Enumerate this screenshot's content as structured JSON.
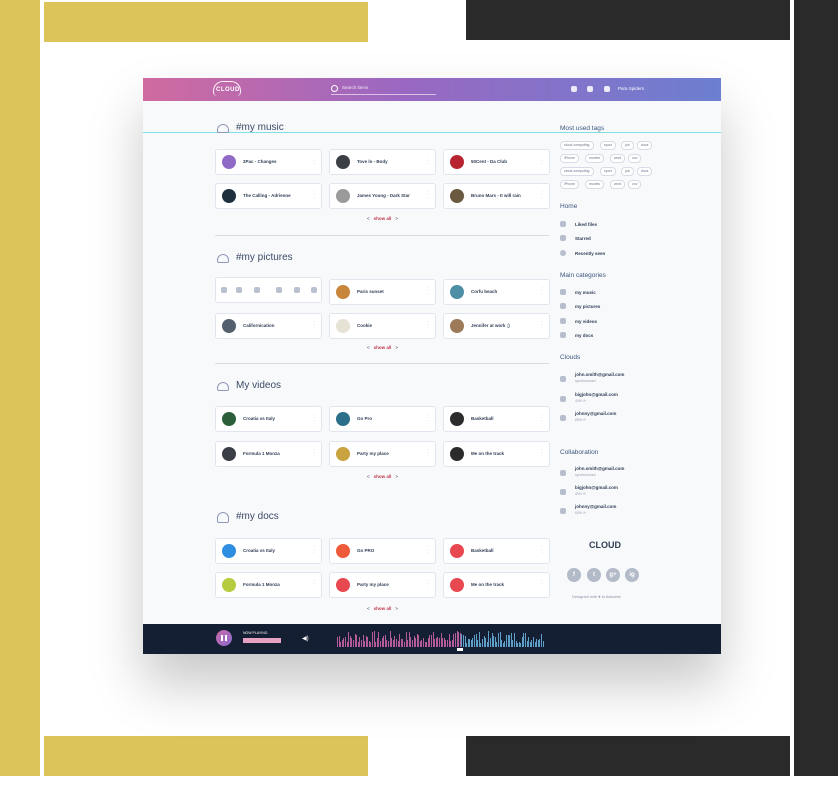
{
  "topbar": {
    "logo": "CLOUD",
    "search_placeholder": "Search items",
    "user_name": "Para Spiders"
  },
  "sections": {
    "music": {
      "title": "#my music",
      "items": [
        "2Pac - Changes",
        "Tove lo - Body",
        "50Cent - Da Club",
        "The Calling - Adrienne",
        "James Young - Dark Star",
        "Bruno Mars - It will rain"
      ],
      "pager": {
        "prev": "<",
        "label": "show all",
        "next": ">"
      }
    },
    "pictures": {
      "title": "#my pictures",
      "items": [
        "Paris sunset",
        "Corfu beach",
        "Californication",
        "Cookie",
        "Jennifer at work ;)"
      ],
      "pager": {
        "prev": "<",
        "label": "show all",
        "next": ">"
      }
    },
    "videos": {
      "title": "My videos",
      "items": [
        "Croatia vs Italy",
        "Go Pro",
        "Basketball",
        "Formula 1 Monza",
        "Party my place",
        "Me on the track"
      ],
      "pager": {
        "prev": "<",
        "label": "show all",
        "next": ">"
      }
    },
    "docs": {
      "title": "#my docs",
      "items": [
        "Croatia vs Italy",
        "Go PRO",
        "Basketball",
        "Formula 1 Monza",
        "Party my place",
        "Me on the track"
      ],
      "pager": {
        "prev": "<",
        "label": "show all",
        "next": ">"
      }
    }
  },
  "sidebar": {
    "tags_title": "Most used tags",
    "tags": [
      "cloud computing",
      "sport",
      "job",
      "docs",
      "iPhone",
      "moviee",
      "work",
      "cov",
      "cloud computing",
      "sport",
      "job",
      "docs",
      "iPhone",
      "movies",
      "work",
      "cov"
    ],
    "home_title": "Home",
    "home_items": [
      "Liked files",
      "Starred",
      "Recently seen"
    ],
    "categories_title": "Main categories",
    "categories": [
      "my music",
      "my pictures",
      "my videos",
      "my docs"
    ],
    "clouds_title": "Clouds",
    "clouds": [
      {
        "email": "john.smith@gmail.com",
        "status": "synchronised"
      },
      {
        "email": "bigjohn@gmail.com",
        "status": "40% ⟳"
      },
      {
        "email": "johnny@gmail.com",
        "status": "65% ⟳"
      }
    ],
    "collab_title": "Collaboration",
    "collab": [
      {
        "email": "john.smith@gmail.com",
        "status": "synchronised"
      },
      {
        "email": "bigjohn@gmail.com",
        "status": "40% ⟳"
      },
      {
        "email": "johnny@gmail.com",
        "status": "65% ⟳"
      }
    ],
    "footer_logo": "CLOUD",
    "social": [
      "f",
      "t",
      "g+",
      "ig"
    ],
    "designed": "Designed with ♥ in Ackwest"
  },
  "player": {
    "now_playing": "NOW PLAYING",
    "volume_icon": "speaker-icon",
    "progress": 0.22
  },
  "colors": {
    "gold": "#dcc35a",
    "dark": "#2a2a2a",
    "accent": "#c0394b"
  }
}
